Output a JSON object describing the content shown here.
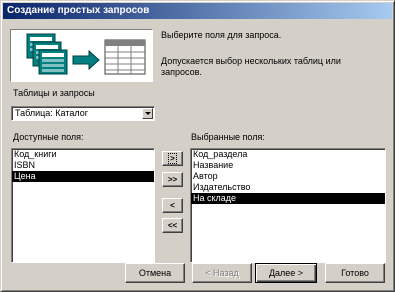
{
  "window": {
    "title": "Создание простых запросов"
  },
  "intro": {
    "line1": "Выберите поля для запроса.",
    "line2a": "Допускается выбор нескольких таблиц или",
    "line2b": "запросов."
  },
  "source": {
    "label": "Таблицы и запросы",
    "selected": "Таблица: Каталог"
  },
  "available": {
    "label": "Доступные поля:",
    "items": [
      "Код_книги",
      "ISBN",
      "Цена"
    ],
    "selected_index": 2
  },
  "chosen": {
    "label": "Выбранные поля:",
    "items": [
      "Код_раздела",
      "Название",
      "Автор",
      "Издательство",
      "На складе"
    ],
    "selected_index": 4
  },
  "move_buttons": {
    "add_one": ">",
    "add_all": ">>",
    "remove_one": "<",
    "remove_all": "<<"
  },
  "footer": {
    "cancel": "Отмена",
    "back": "< Назад",
    "next": "Далее >",
    "finish": "Готово"
  },
  "colors": {
    "title_start": "#0a246a",
    "title_end": "#a6caf0",
    "face": "#d4d0c8",
    "selection": "#000000",
    "icon_teal": "#008080"
  }
}
